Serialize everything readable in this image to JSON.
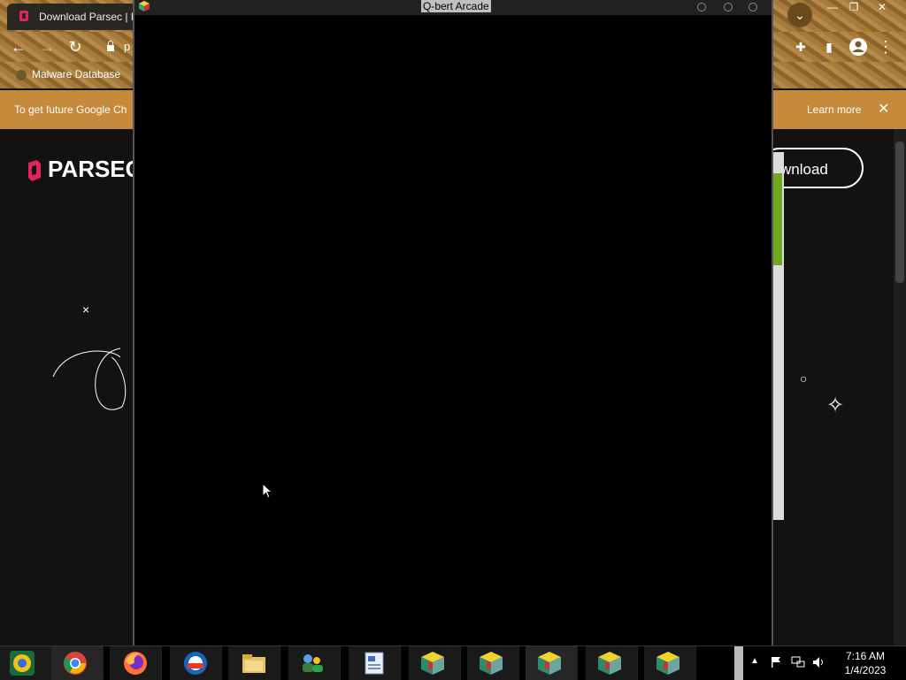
{
  "browser": {
    "tab_title": "Download Parsec | Pa",
    "bookmark": "Malware Database",
    "address_partial": "p",
    "infobar_message": "To get future Google Ch",
    "infobar_learn_more": "Learn more",
    "infobar_close": "✕",
    "back": "←",
    "forward": "→",
    "reload": "↻",
    "extensions": "✚",
    "sidebar": "▮",
    "menu": "⋮",
    "chevron": "⌄",
    "win_min": "—",
    "win_max": "❐",
    "win_close": "✕"
  },
  "page": {
    "logo_text": "PARSEC",
    "download_label": "wnload",
    "deco_x": "×",
    "deco_ring": "○",
    "deco_star": "✧"
  },
  "qbert_window": {
    "title": "Q-bert Arcade"
  },
  "taskbar": {
    "time": "7:16 AM",
    "date": "1/4/2023",
    "items": [
      "chrome-canary",
      "chrome",
      "firefox",
      "outlook",
      "file-explorer",
      "network-app",
      "document-app",
      "cube-app-1",
      "cube-app-2",
      "cube-app-3",
      "cube-app-4",
      "cube-app-5"
    ]
  },
  "colors": {
    "accent_orange": "#c58a3c",
    "parsec_brand": "#e0245e",
    "qbert_window_bg": "#000000"
  }
}
